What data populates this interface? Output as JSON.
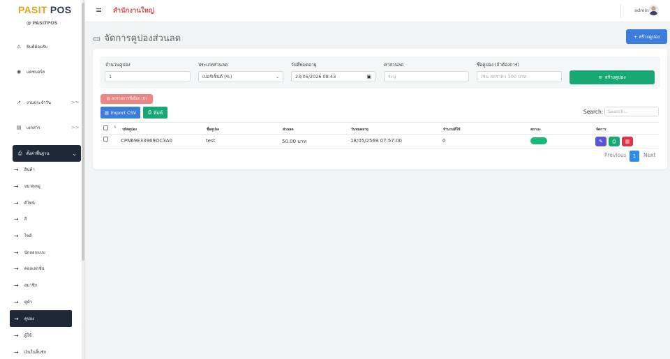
{
  "brand": {
    "part1": "PASIT",
    "part2": "POS",
    "subtitle": "@ PASITPOS"
  },
  "sidebar": {
    "items": [
      {
        "label": "ยินดีต้อนรับ",
        "icon": "warning-icon"
      },
      {
        "label": "แดชบอร์ด",
        "icon": "dashboard-icon"
      },
      {
        "label": "งานประจำวัน",
        "icon": "chart-icon",
        "chevron": ">>"
      },
      {
        "label": "เอกสาร",
        "icon": "document-icon",
        "chevron": ">>"
      }
    ],
    "active_group": {
      "label": "ตั้งค่าพื้นฐาน",
      "icon": "print-icon",
      "chevron": "⌄"
    },
    "sub_items": [
      "สินค้า",
      "หมวดหมู่",
      "ดีไซน์",
      "สี",
      "ไซส์",
      "นักออกแบบ",
      "คอลเลกชั่น",
      "สมาชิก",
      "คู่ค้า"
    ],
    "sub_active": "คูปอง",
    "sub_after": [
      "ผู้ใช้",
      "เงินในลิ้นชัก"
    ]
  },
  "topbar": {
    "branch": "สำนักงานใหญ่",
    "user": "admin"
  },
  "page": {
    "title": "จัดการคูปองส่วนลด",
    "create_button": "+ สร้างคูปอง"
  },
  "form": {
    "qty_label": "จำนวนคูปอง",
    "qty_value": "1",
    "type_label": "ประเภทส่วนลด",
    "type_value": "เปอร์เซ็นต์ (%)",
    "expire_label": "วันที่หมดอายุ",
    "expire_value": "23/05/2026 08:43",
    "discount_label": "ค่าส่วนลด",
    "discount_placeholder": "ระบุ",
    "name_label": "ชื่อคูปอง (ถ้าต้องการ)",
    "name_placeholder": "เช่น ลดราคา 100 บาท",
    "submit": "สร้างคูปอง"
  },
  "toolbar": {
    "delete_selected": "ลบรายการที่เลือก (0)",
    "export_csv": "Export CSV",
    "print": "พิมพ์",
    "search_label": "Search:",
    "search_placeholder": "Search..."
  },
  "table": {
    "columns": [
      "รหัสคูปอง",
      "ชื่อคูปอง",
      "ส่วนลด",
      "วันหมดอายุ",
      "จำนวนที่ใช้",
      "สถานะ",
      "จัดการ"
    ],
    "rows": [
      {
        "code": "CPN69E33969DC3A0",
        "name": "test",
        "discount": "50.00 บาท",
        "expire": "18/05/2569 07:57:00",
        "used": "0",
        "status": "",
        "status_color": "#18b877"
      }
    ]
  },
  "pagination": {
    "previous": "Previous",
    "current": "1",
    "next": "Next"
  },
  "colors": {
    "primary": "#3b7ddd",
    "success": "#18a875",
    "danger": "#dc3545",
    "sidebar_active": "#1f2838",
    "brand_accent": "#e8a317"
  }
}
